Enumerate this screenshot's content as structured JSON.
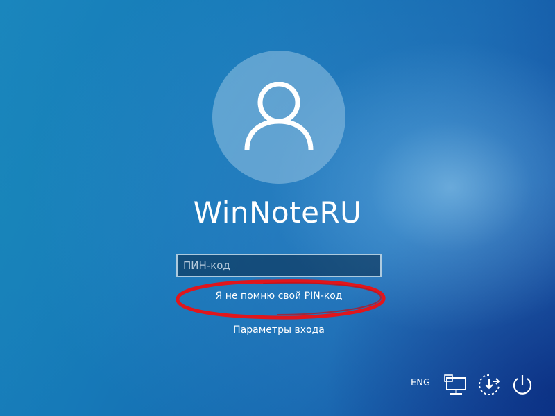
{
  "user": {
    "name": "WinNoteRU",
    "avatar_icon": "user-silhouette-icon"
  },
  "pin": {
    "placeholder": "ПИН-код",
    "value": ""
  },
  "links": {
    "forgot_pin": "Я не помню свой PIN-код",
    "signin_options": "Параметры входа"
  },
  "tray": {
    "language": "ENG",
    "icons": [
      "network-icon",
      "ease-of-access-icon",
      "power-icon"
    ]
  },
  "colors": {
    "highlight_ellipse": "#e0161c",
    "text": "#ffffff"
  }
}
